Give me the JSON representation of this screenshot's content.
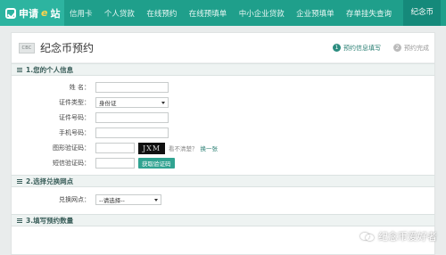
{
  "nav": {
    "brand_prefix": "申请",
    "brand_e": "e",
    "brand_suffix": "站",
    "items": [
      "信用卡",
      "个人贷款",
      "在线预约",
      "在线预填单",
      "中小企业贷款",
      "企业预填单",
      "存单挂失查询"
    ],
    "active_item": "纪念币"
  },
  "page": {
    "logo_text": "CBC",
    "title": "纪念币预约",
    "steps": [
      {
        "num": "1",
        "label": "预约信息填写"
      },
      {
        "num": "2",
        "label": "预约完成"
      }
    ]
  },
  "section1": {
    "title": "1.您的个人信息",
    "name_label": "姓 名：",
    "idtype_label": "证件类型：",
    "idtype_value": "身份证",
    "idnum_label": "证件号码：",
    "phone_label": "手机号码：",
    "captcha_label": "图形验证码：",
    "captcha_text": "JXM",
    "captcha_hint": "看不清楚？",
    "captcha_refresh": "换一张",
    "sms_label": "短信验证码：",
    "sms_button": "获取验证码"
  },
  "section2": {
    "title": "2.选择兑换网点",
    "branch_label": "兑换网点：",
    "branch_value": "--请选择--"
  },
  "section3": {
    "title": "3.填写预约数量"
  },
  "watermark": {
    "text": "纪念币爱好者",
    "icon": "wechat-icon"
  },
  "colors": {
    "nav_bg": "#1f9f8b",
    "accent": "#2b8c7f",
    "button": "#30a391"
  }
}
